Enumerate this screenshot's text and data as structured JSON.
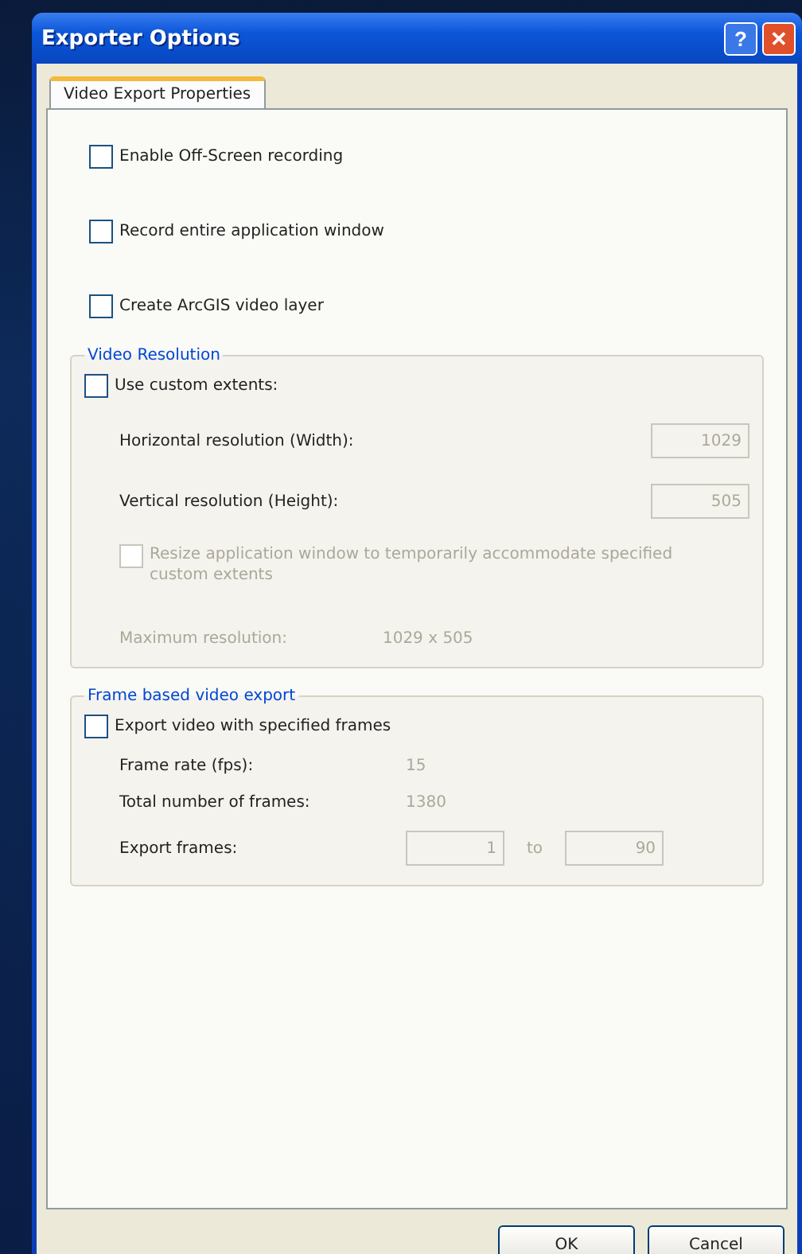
{
  "window": {
    "title": "Exporter Options",
    "title_buttons": [
      "?",
      "✕"
    ]
  },
  "tabs": [
    {
      "label": "Video Export Properties",
      "selected": true
    }
  ],
  "options": [
    {
      "label": "Enable Off-Screen recording",
      "checked": false
    },
    {
      "label": "Record entire application window",
      "checked": false
    },
    {
      "label": "Create ArcGIS video layer",
      "checked": false
    }
  ],
  "video_resolution": {
    "title": "Video Resolution",
    "custom": {
      "label": "Use custom extents:",
      "checked": false
    },
    "fields": [
      {
        "label": "Horizontal resolution (Width):",
        "value": "1029",
        "disabled": true
      },
      {
        "label": "Vertical resolution (Height):",
        "value": "505",
        "disabled": true
      }
    ],
    "resize": {
      "label": "Resize application window to temporarily accommodate specified custom extents",
      "checked": false,
      "disabled": true
    },
    "maximum": {
      "label": "Maximum resolution:",
      "value": "1029 x 505"
    }
  },
  "frame_export": {
    "title": "Frame based video export",
    "custom": {
      "label": "Export video with specified frames",
      "checked": false
    },
    "frame_rate": {
      "label": "Frame rate (fps):",
      "value": "15"
    },
    "total": {
      "label": "Total number of frames:",
      "value": "1380"
    },
    "range": {
      "label": "Export frames:",
      "from": "1",
      "separator": "to",
      "to": "90",
      "disabled": true
    }
  },
  "buttons": [
    "OK",
    "Cancel"
  ]
}
